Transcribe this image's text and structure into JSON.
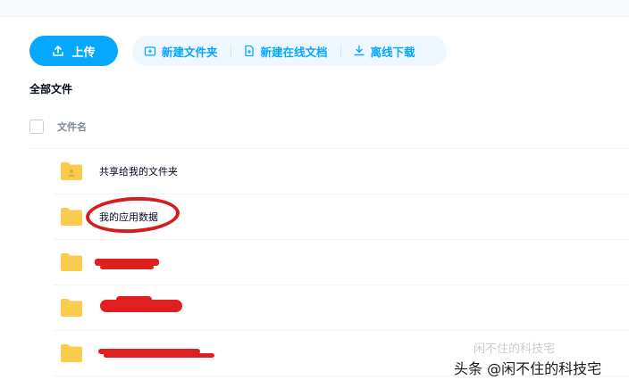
{
  "toolbar": {
    "upload_label": "上传",
    "new_folder_label": "新建文件夹",
    "new_online_doc_label": "新建在线文档",
    "offline_download_label": "离线下载"
  },
  "breadcrumb": "全部文件",
  "table": {
    "column_name": "文件名",
    "rows": [
      {
        "name": "共享给我的文件夹",
        "icon": "shared-folder-icon"
      },
      {
        "name": "我的应用数据",
        "icon": "folder-icon"
      },
      {
        "name": "",
        "icon": "folder-icon",
        "redacted": true
      },
      {
        "name": "",
        "icon": "folder-icon",
        "redacted": true
      },
      {
        "name": "",
        "icon": "folder-icon",
        "redacted": true
      }
    ]
  },
  "watermark": "头条 @闲不住的科技宅",
  "watermark_ghost": "闲不住的科技宅",
  "colors": {
    "accent": "#06a7ff",
    "folder": "#f9cc4d",
    "redaction": "#e02020"
  }
}
